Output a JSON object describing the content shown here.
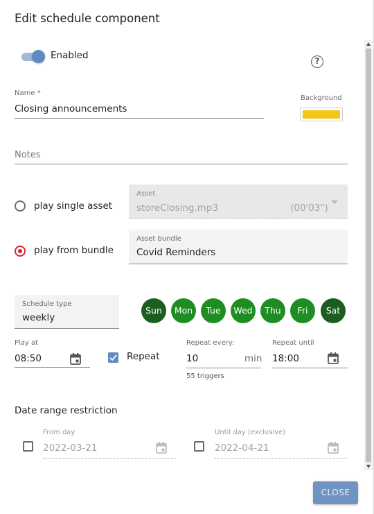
{
  "dialog": {
    "title": "Edit schedule component",
    "enabled_label": "Enabled",
    "help_icon": "?",
    "close_label": "CLOSE"
  },
  "name_field": {
    "label": "Name *",
    "value": "Closing announcements"
  },
  "background": {
    "label": "Background",
    "color": "#f5c518"
  },
  "notes_field": {
    "placeholder": "Notes"
  },
  "source": {
    "single_label": "play single asset",
    "bundle_label": "play from bundle",
    "asset_label": "Asset",
    "asset_value": "storeClosing.mp3",
    "asset_duration": "(00'03\")",
    "bundle_field_label": "Asset bundle",
    "bundle_value": "Covid Reminders"
  },
  "schedule": {
    "type_label": "Schedule type",
    "type_value": "weekly",
    "days": [
      {
        "label": "Sun",
        "color": "#1b5e20"
      },
      {
        "label": "Mon",
        "color": "#1e8e23"
      },
      {
        "label": "Tue",
        "color": "#1e8e23"
      },
      {
        "label": "Wed",
        "color": "#1e8e23"
      },
      {
        "label": "Thu",
        "color": "#1e8e23"
      },
      {
        "label": "Fri",
        "color": "#1e8e23"
      },
      {
        "label": "Sat",
        "color": "#1b5e20"
      }
    ]
  },
  "timing": {
    "play_at_label": "Play at",
    "play_at_value": "08:50",
    "repeat_label": "Repeat",
    "repeat_every_label": "Repeat every:",
    "repeat_every_value": "10",
    "repeat_every_unit": "min",
    "triggers": "55 triggers",
    "repeat_until_label": "Repeat until",
    "repeat_until_value": "18:00"
  },
  "date_range": {
    "title": "Date range restriction",
    "from_label": "From day",
    "from_value": "2022-03-21",
    "until_label": "Until day (exclusive)",
    "until_value": "2022-04-21"
  }
}
